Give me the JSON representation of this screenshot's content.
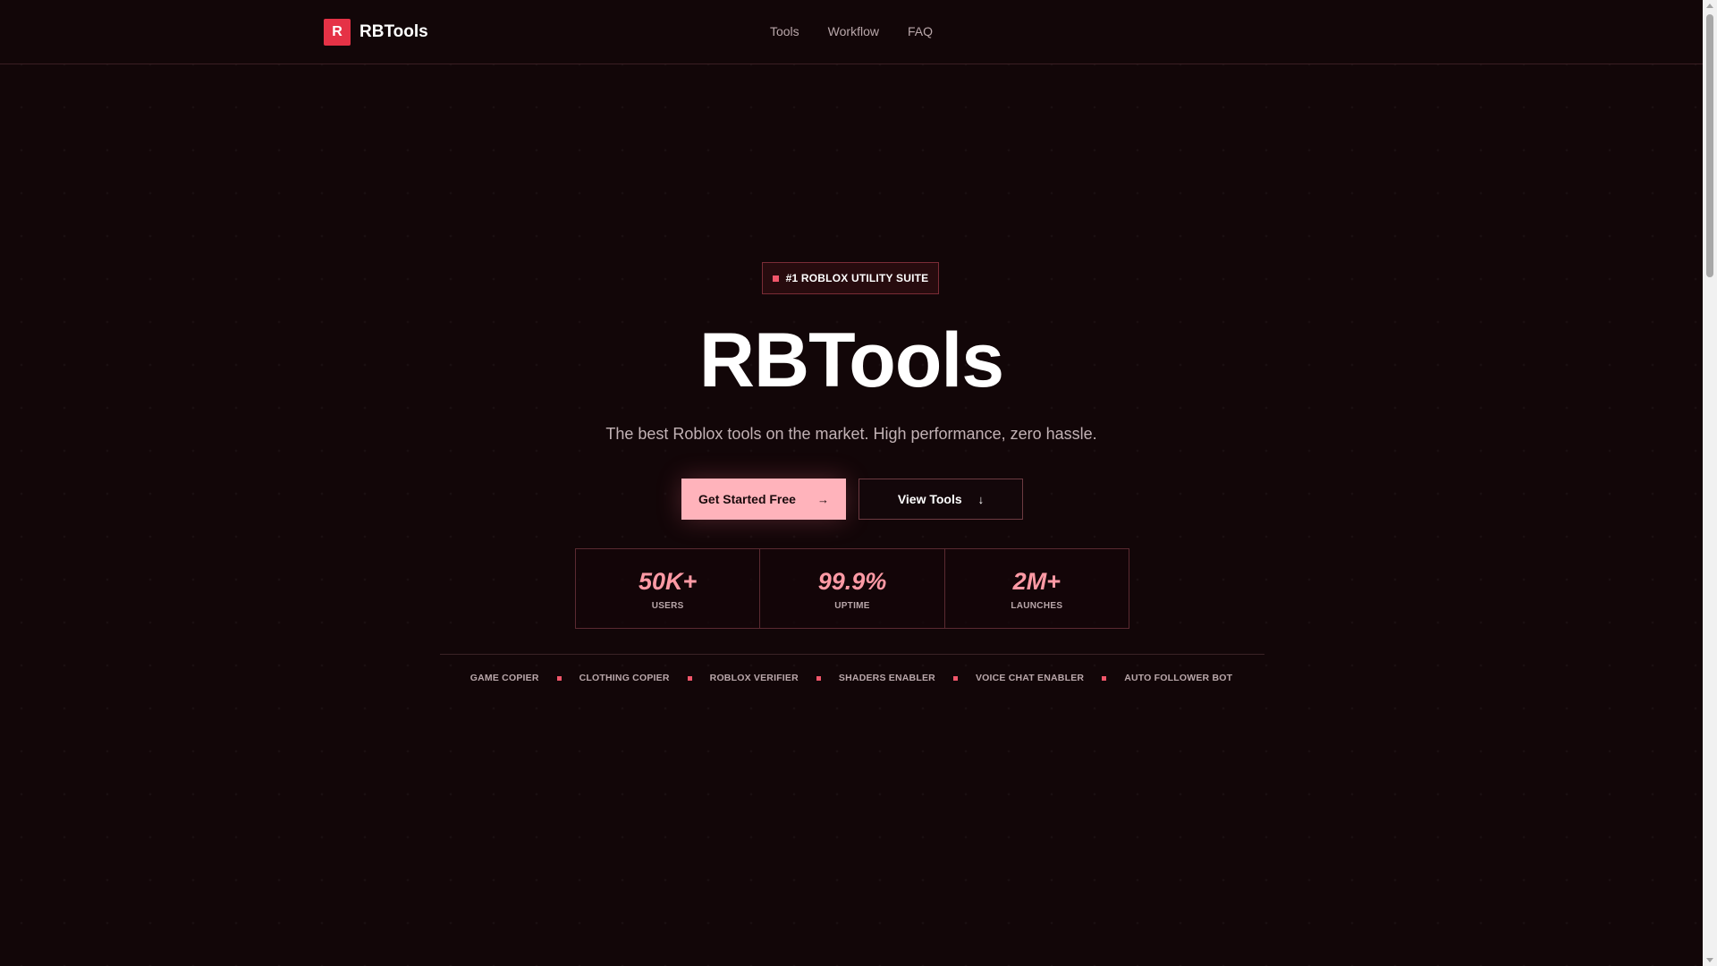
{
  "nav": {
    "logo_mark": "R",
    "logo_text": "RBTools",
    "links": [
      "Tools",
      "Workflow",
      "FAQ"
    ]
  },
  "hero": {
    "badge": "#1 ROBLOX UTILITY SUITE",
    "title": "RBTools",
    "subtitle": "The best Roblox tools on the market. High performance, zero hassle.",
    "primary_button": "Get Started Free",
    "primary_icon": "→",
    "secondary_button": "View Tools",
    "secondary_icon": "↓"
  },
  "stats": [
    {
      "value": "50K+",
      "label": "USERS"
    },
    {
      "value": "99.9%",
      "label": "UPTIME"
    },
    {
      "value": "2M+",
      "label": "LAUNCHES"
    }
  ],
  "tools": [
    "GAME COPIER",
    "CLOTHING COPIER",
    "ROBLOX VERIFIER",
    "SHADERS ENABLER",
    "VOICE CHAT ENABLER",
    "AUTO FOLLOWER BOT"
  ],
  "colors": {
    "accent": "#e53246",
    "primary_button": "#ffb3bb",
    "stat_value": "#ff9aa5",
    "background": "#120608"
  }
}
